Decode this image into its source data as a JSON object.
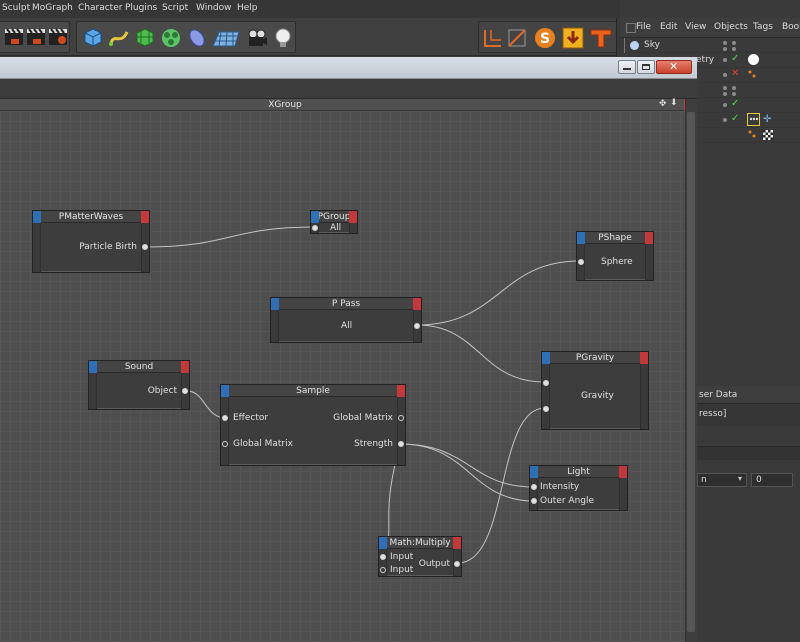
{
  "menubar": {
    "items": [
      "Sculpt",
      "MoGraph",
      "Character",
      "Plugins",
      "Script",
      "Window",
      "Help"
    ]
  },
  "object_manager": {
    "menu": [
      "File",
      "Edit",
      "View",
      "Objects",
      "Tags",
      "Book"
    ],
    "rows": [
      {
        "name": "Sky"
      },
      {
        "name": "etry"
      },
      {
        "name": ""
      },
      {
        "name": ""
      },
      {
        "name": ""
      },
      {
        "name": ""
      }
    ]
  },
  "xpresso": {
    "group_title": "XGroup",
    "side_texts": {
      "user_data": "ser Data",
      "xpresso": "resso]",
      "dropdown": "n",
      "number": "0"
    }
  },
  "nodes": [
    {
      "id": "pmatterwaves",
      "title": "PMatterWaves",
      "outputs": [
        "Particle Birth"
      ],
      "inputs": []
    },
    {
      "id": "pgroup",
      "title": "PGroup",
      "inputs": [
        "All"
      ],
      "outputs": []
    },
    {
      "id": "pshape",
      "title": "PShape",
      "inputs": [
        "Sphere"
      ],
      "outputs": []
    },
    {
      "id": "ppass",
      "title": "P Pass",
      "inputs": [],
      "outputs": [
        "All"
      ]
    },
    {
      "id": "sound",
      "title": "Sound",
      "inputs": [],
      "outputs": [
        "Object"
      ]
    },
    {
      "id": "sample",
      "title": "Sample",
      "inputs": [
        "Effector",
        "Global Matrix"
      ],
      "outputs": [
        "Global Matrix",
        "Strength"
      ]
    },
    {
      "id": "pgravity",
      "title": "PGravity",
      "inputs": [],
      "outputs": [],
      "body": "Gravity"
    },
    {
      "id": "light",
      "title": "Light",
      "inputs": [
        "Intensity",
        "Outer Angle"
      ],
      "outputs": []
    },
    {
      "id": "mathmultiply",
      "title": "Math:Multiply",
      "inputs": [
        "Input",
        "Input"
      ],
      "outputs": [
        "Output"
      ]
    }
  ],
  "colors": {
    "input_cap": "#2f6fb5",
    "output_cap": "#c2393c",
    "wire": "#d8d8d8",
    "canvas": "#4e4e4e"
  }
}
